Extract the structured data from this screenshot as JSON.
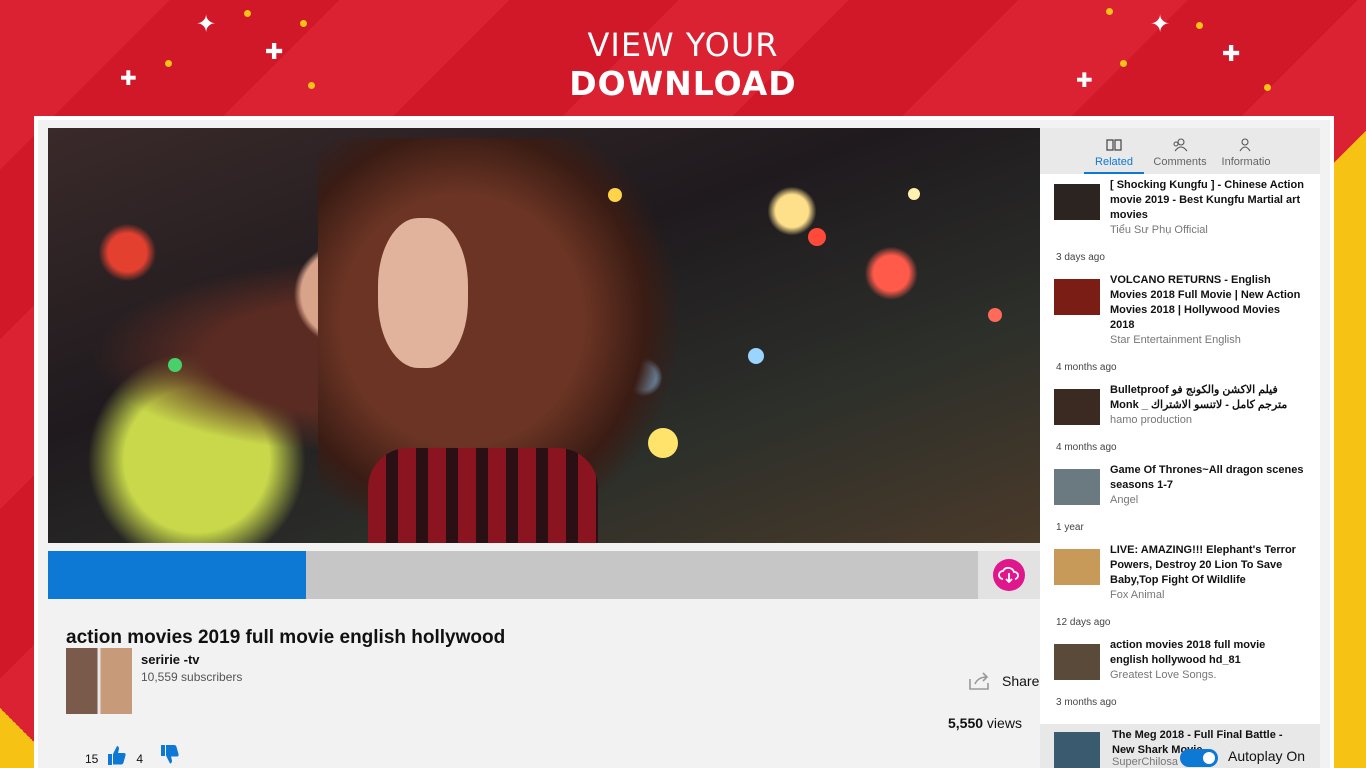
{
  "hero": {
    "line1": "VIEW YOUR",
    "line2": "DOWNLOAD"
  },
  "video": {
    "title": "action movies 2019 full movie english hollywood",
    "progress_fraction": 0.26,
    "download_icon": "cloud-download-icon"
  },
  "channel": {
    "name": "seririe -tv",
    "subscribers": "10,559 subscribers"
  },
  "actions": {
    "share_label": "Share",
    "views_count": "5,550",
    "views_suffix": " views",
    "likes": "15",
    "dislikes": "4"
  },
  "sidebar": {
    "tabs": [
      {
        "label": "Related",
        "icon": "book-icon"
      },
      {
        "label": "Comments",
        "icon": "people-icon"
      },
      {
        "label": "Informatio",
        "icon": "person-icon"
      }
    ],
    "items": [
      {
        "title": "[ Shocking Kungfu ] - Chinese Action movie 2019 - Best Kungfu Martial art movies",
        "channel": "Tiểu Sư Phụ Official",
        "ago": "3 days ago",
        "thumb": "#2b2420"
      },
      {
        "title": "VOLCANO RETURNS - English Movies 2018 Full Movie | New Action Movies 2018 | Hollywood Movies 2018",
        "channel": "Star Entertainment English",
        "ago": "4 months ago",
        "thumb": "#7a1d14"
      },
      {
        "title": "Bulletproof فيلم الاكشن والكونج فو Monk _ مترجم كامل - لاتنسو الاشتراك",
        "channel": "hamo production",
        "ago": "4 months ago",
        "thumb": "#3a2a22"
      },
      {
        "title": "Game Of Thrones~All dragon scenes seasons 1-7",
        "channel": "Angel",
        "ago": "1 year",
        "thumb": "#6b7a80"
      },
      {
        "title": "LIVE: AMAZING!!! Elephant's Terror Powers, Destroy 20 Lion To Save Baby,Top Fight Of Wildlife",
        "channel": "Fox Animal",
        "ago": "12 days ago",
        "thumb": "#c89a5a"
      },
      {
        "title": "action movies 2018 full movie english hollywood hd_81",
        "channel": "Greatest Love Songs.",
        "ago": "3 months ago",
        "thumb": "#5a4a3a"
      }
    ],
    "autoplay": {
      "title": "The Meg 2018 - Full Final Battle - New Shark Movie",
      "channel": "SuperChilosa",
      "label": "Autoplay On",
      "thumb": "#3a5a70"
    }
  },
  "colors": {
    "brand_red": "#d8192b",
    "accent_blue": "#0e78d5",
    "download_pink": "#e0178c",
    "yellow": "#f6c315"
  }
}
